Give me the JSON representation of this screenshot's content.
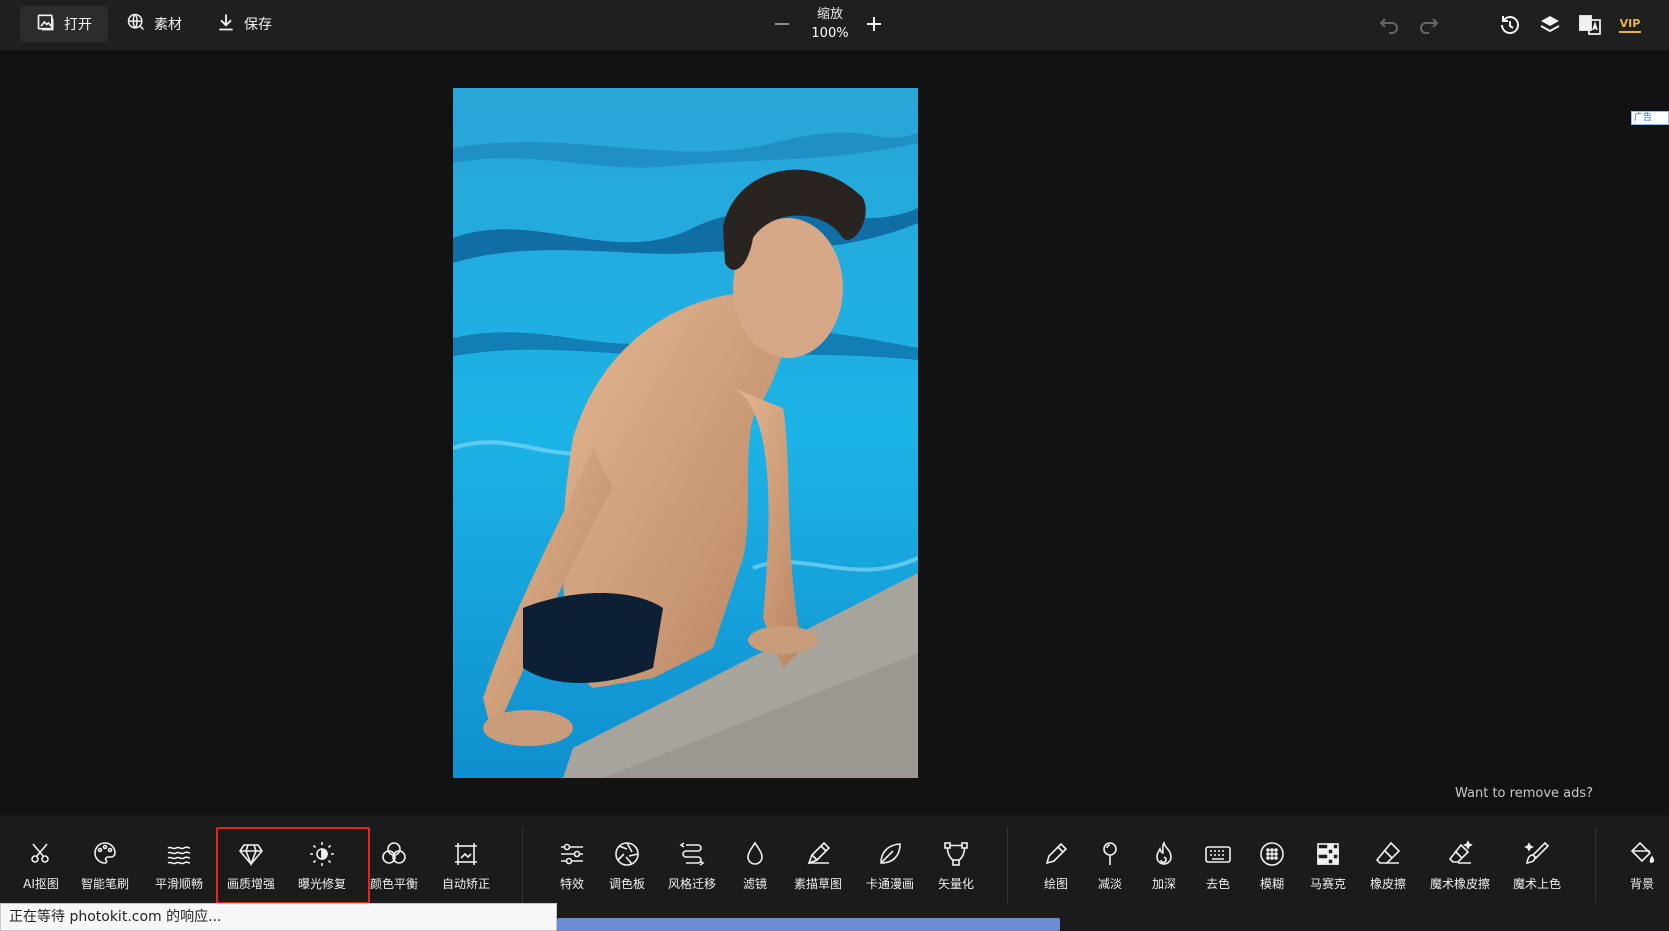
{
  "topbar": {
    "open_label": "打开",
    "assets_label": "素材",
    "save_label": "保存",
    "zoom_label": "缩放",
    "zoom_value": "100%",
    "vip_label": "VIP"
  },
  "ad": {
    "chip_label": "广告",
    "remove_ads_text": "Want to remove ads?"
  },
  "toolbar": {
    "tools": [
      {
        "label": "AI抠图",
        "icon": "scissors-icon"
      },
      {
        "label": "智能笔刷",
        "icon": "palette-icon"
      },
      {
        "label": "平滑顺畅",
        "icon": "waves-icon"
      },
      {
        "label": "画质增强",
        "icon": "diamond-icon"
      },
      {
        "label": "曝光修复",
        "icon": "brightness-icon"
      },
      {
        "label": "颜色平衡",
        "icon": "color-circles-icon"
      },
      {
        "label": "自动矫正",
        "icon": "crop-frame-icon"
      },
      {
        "label": "特效",
        "icon": "sliders-icon"
      },
      {
        "label": "调色板",
        "icon": "aperture-icon"
      },
      {
        "label": "风格迁移",
        "icon": "style-transfer-icon"
      },
      {
        "label": "滤镜",
        "icon": "drop-icon"
      },
      {
        "label": "素描草图",
        "icon": "sketch-pen-icon"
      },
      {
        "label": "卡通漫画",
        "icon": "leaf-icon"
      },
      {
        "label": "矢量化",
        "icon": "vector-nodes-icon"
      },
      {
        "label": "绘图",
        "icon": "pencil-icon"
      },
      {
        "label": "减淡",
        "icon": "dodge-icon"
      },
      {
        "label": "加深",
        "icon": "flame-icon"
      },
      {
        "label": "去色",
        "icon": "keyboard-icon"
      },
      {
        "label": "模糊",
        "icon": "blur-icon"
      },
      {
        "label": "马赛克",
        "icon": "mosaic-icon"
      },
      {
        "label": "橡皮擦",
        "icon": "eraser-icon"
      },
      {
        "label": "魔术橡皮擦",
        "icon": "magic-eraser-icon"
      },
      {
        "label": "魔术上色",
        "icon": "magic-brush-icon"
      },
      {
        "label": "背景",
        "icon": "paint-bucket-icon"
      }
    ]
  },
  "status": {
    "text": "正在等待 photokit.com 的响应..."
  }
}
